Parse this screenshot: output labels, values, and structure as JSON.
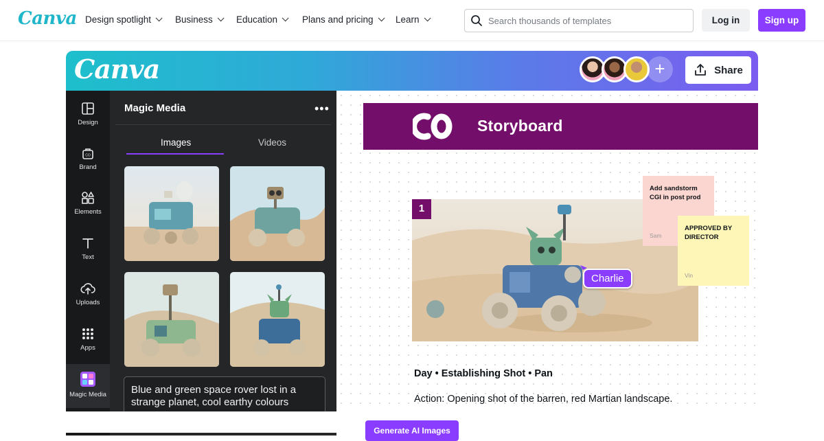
{
  "site": {
    "logo": "Canva"
  },
  "nav": {
    "items": [
      "Design spotlight",
      "Business",
      "Education",
      "Plans and pricing",
      "Learn"
    ],
    "search_placeholder": "Search thousands of templates",
    "login": "Log in",
    "signup": "Sign up"
  },
  "editor": {
    "logo": "Canva",
    "share": "Share",
    "rail": [
      "Design",
      "Brand",
      "Elements",
      "Text",
      "Uploads",
      "Apps",
      "Magic Media"
    ],
    "panel": {
      "title": "Magic Media",
      "tabs": [
        "Images",
        "Videos"
      ],
      "prompt": "Blue and green space rover lost in a strange planet, cool earthy colours",
      "generate": "Generate AI Images"
    },
    "canvas": {
      "banner_title": "Storyboard",
      "scene_number": "1",
      "cursor_name": "Charlie",
      "notes": [
        {
          "text": "Add sandstorm CGI in post prod",
          "author": "Sam"
        },
        {
          "text": "APPROVED BY DIRECTOR",
          "author": "Vin"
        }
      ],
      "scene_title": "Day • Establishing Shot • Pan",
      "action": "Action: Opening shot of the barren, red Martian landscape."
    }
  },
  "colors": {
    "brand_purple": "#8b3dff",
    "storyboard_purple": "#730f6a",
    "logo_teal": "#20b6c9"
  }
}
